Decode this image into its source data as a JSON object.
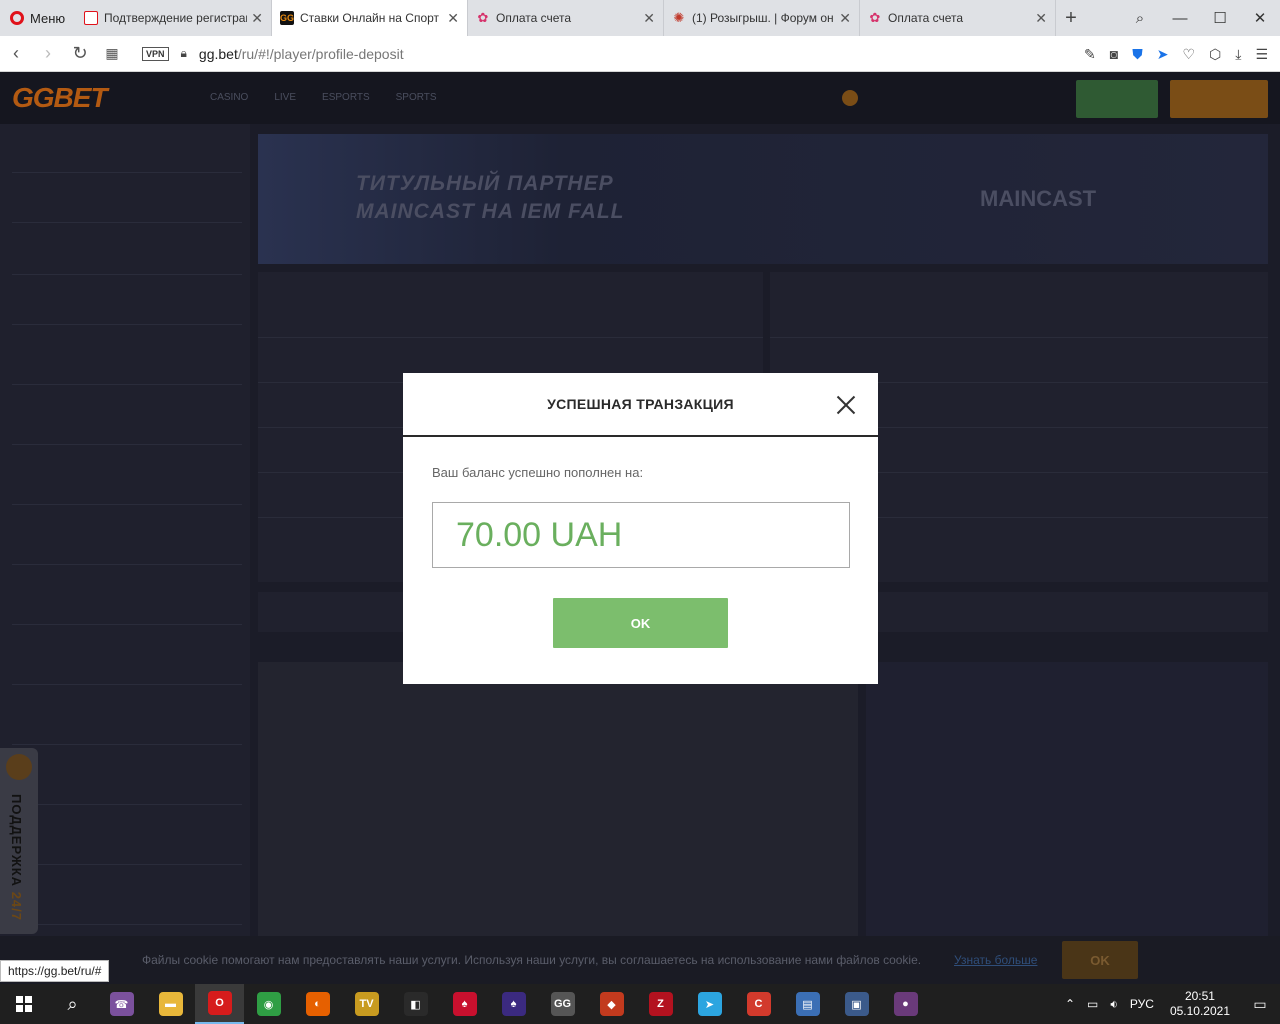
{
  "browser": {
    "menu_label": "Меню",
    "tabs": [
      {
        "title": "Подтверждение регистрац",
        "favicon": "opera-page-icon",
        "active": false
      },
      {
        "title": "Ставки Онлайн на Спорт и",
        "favicon": "ggbet-icon",
        "active": true
      },
      {
        "title": "Оплата счета",
        "favicon": "flower-icon",
        "active": false
      },
      {
        "title": "(1) Розыгрыш. | Форум он",
        "favicon": "forum-icon",
        "active": false
      },
      {
        "title": "Оплата счета",
        "favicon": "flower-icon",
        "active": false
      }
    ],
    "vpn_label": "VPN",
    "url_host": "gg.bet",
    "url_path": "/ru/#!/player/profile-deposit",
    "status_url": "https://gg.bet/ru/#"
  },
  "site": {
    "logo": "GGBET",
    "nav": [
      "CASINO",
      "LIVE",
      "ESPORTS",
      "SPORTS"
    ],
    "banner_line1": "ТИТУЛЬНЫЙ ПАРТНЕР",
    "banner_line2": "MAINCAST НА IEM FALL",
    "banner_brand": "MAINCAST",
    "support_label_1": "ПОДДЕРЖКА",
    "support_label_2": "24/7",
    "cookie_text": "Файлы cookie помогают нам предоставлять наши услуги. Используя наши услуги, вы соглашаетесь на использование нами файлов cookie.",
    "cookie_link": "Узнать больше",
    "cookie_ok": "OK"
  },
  "modal": {
    "title": "УСПЕШНАЯ ТРАНЗАКЦИЯ",
    "message": "Ваш баланс успешно пополнен на:",
    "amount": "70.00 UAH",
    "ok_label": "OK"
  },
  "taskbar": {
    "lang": "РУС",
    "time": "20:51",
    "date": "05.10.2021",
    "apps": [
      {
        "name": "viber-icon",
        "color": "#7b519d",
        "glyph": "☎"
      },
      {
        "name": "folder-icon",
        "color": "#e8b73a",
        "glyph": "▬"
      },
      {
        "name": "opera-icon",
        "color": "#d61c1c",
        "glyph": "O"
      },
      {
        "name": "chrome-icon",
        "color": "#2f9e44",
        "glyph": "◉"
      },
      {
        "name": "firefox-icon",
        "color": "#e66000",
        "glyph": "◐"
      },
      {
        "name": "tv-icon",
        "color": "#c89b20",
        "glyph": "TV"
      },
      {
        "name": "game-icon",
        "color": "#2a2a2a",
        "glyph": "◧"
      },
      {
        "name": "poker-icon",
        "color": "#c8102e",
        "glyph": "♠"
      },
      {
        "name": "spade-icon",
        "color": "#3b2a80",
        "glyph": "♠"
      },
      {
        "name": "gg-icon",
        "color": "#555555",
        "glyph": "GG"
      },
      {
        "name": "diamond-icon",
        "color": "#c23a1e",
        "glyph": "◆"
      },
      {
        "name": "z-icon",
        "color": "#b3121f",
        "glyph": "Z"
      },
      {
        "name": "telegram-icon",
        "color": "#2ca5e0",
        "glyph": "➤"
      },
      {
        "name": "ccleaner-icon",
        "color": "#d23a2c",
        "glyph": "C"
      },
      {
        "name": "network-icon",
        "color": "#3b6fb5",
        "glyph": "▤"
      },
      {
        "name": "app-icon",
        "color": "#3b5a8a",
        "glyph": "▣"
      },
      {
        "name": "plum-icon",
        "color": "#6a3a7a",
        "glyph": "●"
      }
    ]
  }
}
